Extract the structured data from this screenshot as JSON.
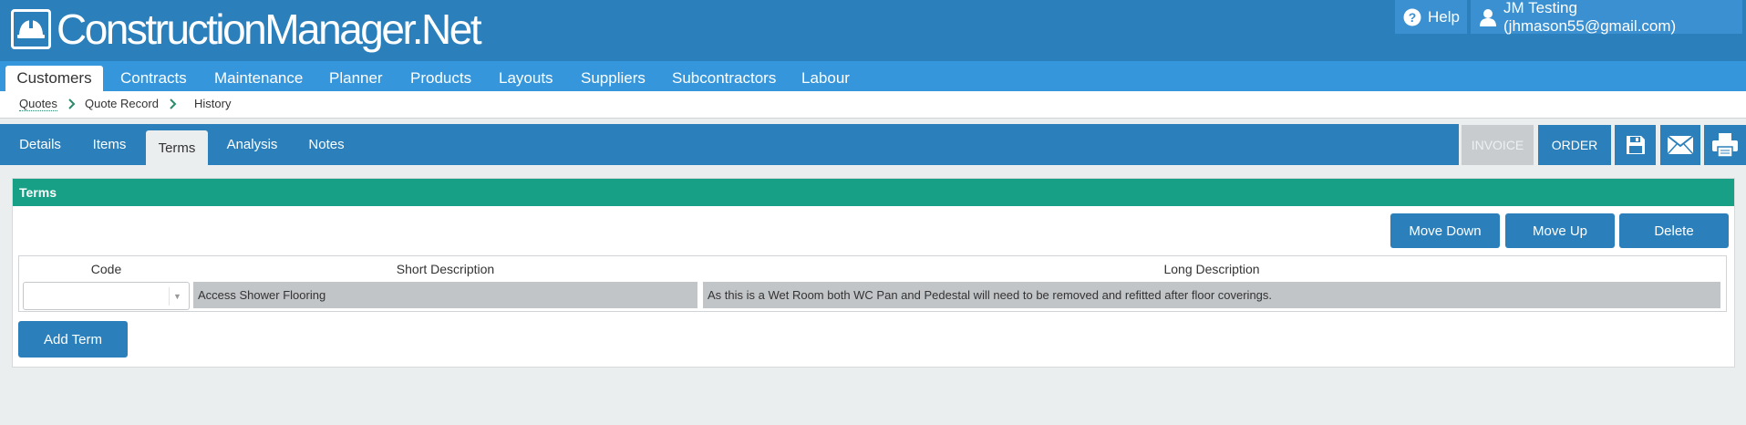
{
  "app": {
    "logo_text": "ConstructionManager.Net",
    "help_label": "Help",
    "user_label": "JM Testing (jhmason55@gmail.com)"
  },
  "main_nav": [
    "Customers",
    "Contracts",
    "Maintenance",
    "Planner",
    "Products",
    "Layouts",
    "Suppliers",
    "Subcontractors",
    "Labour"
  ],
  "breadcrumb": [
    "Quotes",
    "Quote Record",
    "History"
  ],
  "sub_tabs": [
    "Details",
    "Items",
    "Terms",
    "Analysis",
    "Notes"
  ],
  "toolbar": {
    "invoice_label": "INVOICE",
    "order_label": "ORDER",
    "save_icon": "save-icon",
    "email_icon": "envelope-icon",
    "print_icon": "printer-icon"
  },
  "panel": {
    "title": "Terms",
    "actions": [
      "Move Down",
      "Move Up",
      "Delete"
    ],
    "columns": [
      "Code",
      "Short Description",
      "Long Description"
    ],
    "rows": [
      {
        "code": "",
        "short_description": "Access Shower Flooring",
        "long_description": "As this is a Wet Room both WC Pan and Pedestal will need to be removed and refitted after floor coverings."
      }
    ],
    "add_label": "Add Term"
  },
  "colors": {
    "header_blue": "#2b80bc",
    "nav_blue": "#3596db",
    "panel_green": "#17a085",
    "disabled_gray": "#c8ccce"
  }
}
